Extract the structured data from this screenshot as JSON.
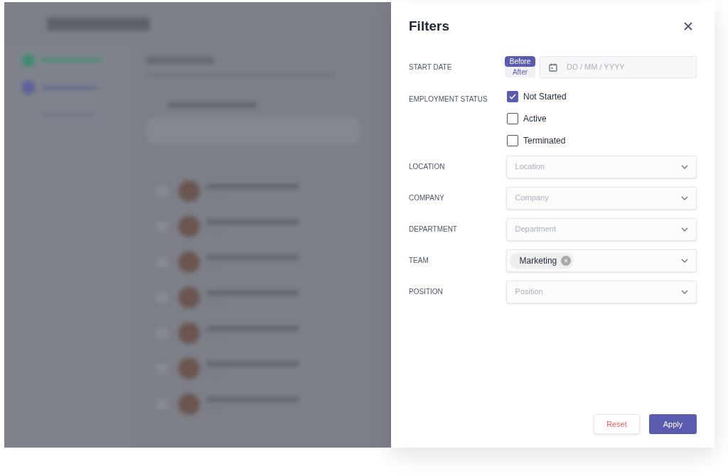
{
  "filters": {
    "title": "Filters",
    "start_date": {
      "label": "START DATE",
      "modes": [
        {
          "label": "Before",
          "selected": true
        },
        {
          "label": "After",
          "selected": false
        }
      ],
      "placeholder": "DD / MM / YYYY"
    },
    "employment_status": {
      "label": "EMPLOYMENT STATUS",
      "options": [
        {
          "label": "Not Started",
          "checked": true
        },
        {
          "label": "Active",
          "checked": false
        },
        {
          "label": "Terminated",
          "checked": false
        }
      ]
    },
    "selects": [
      {
        "label": "LOCATION",
        "placeholder": "Location"
      },
      {
        "label": "COMPANY",
        "placeholder": "Company"
      },
      {
        "label": "DEPARTMENT",
        "placeholder": "Department"
      },
      {
        "label": "TEAM",
        "chips": [
          "Marketing"
        ]
      },
      {
        "label": "POSITION",
        "placeholder": "Position"
      }
    ],
    "buttons": {
      "reset": "Reset",
      "apply": "Apply"
    }
  }
}
